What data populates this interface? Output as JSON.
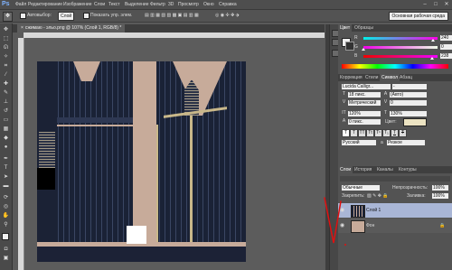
{
  "app": {
    "logo": "Ps"
  },
  "menu": [
    "Файл",
    "Редактирование",
    "Изображение",
    "Слои",
    "Текст",
    "Выделение",
    "Фильтр",
    "3D",
    "Просмотр",
    "Окно",
    "Справка"
  ],
  "window_controls": [
    "–",
    "□",
    "✕"
  ],
  "options_bar": {
    "auto_select_label": "Автовыбор:",
    "auto_select_value": "Слой",
    "show_controls_label": "Показать упр. элем.",
    "workspace": "Основная рабочая среда"
  },
  "document_tab": {
    "close": "×",
    "title": "сжимаю - эльо.png @ 107% (Слой 1, RGB/8) *"
  },
  "color_panel": {
    "tabs": [
      "Цвет",
      "Образцы"
    ],
    "channels": [
      {
        "label": "R",
        "value": "240",
        "gradient": [
          "#00f0e8",
          "#ff00e8"
        ],
        "knob": 0.94
      },
      {
        "label": "G",
        "value": "0",
        "gradient": [
          "#f000e8",
          "#f0ffe8"
        ],
        "knob": 0.0
      },
      {
        "label": "B",
        "value": "238",
        "gradient": [
          "#f00000",
          "#f000ff"
        ],
        "knob": 0.93
      }
    ]
  },
  "character_panel": {
    "tabs": [
      "Коррекция",
      "Стили",
      "Символ",
      "Абзац"
    ],
    "font_family": "Lucida Calligr...",
    "font_style": "-",
    "size": "18 пикс.",
    "leading": "(Авто)",
    "kerning": "Метрический",
    "tracking": "0",
    "vertical_scale": "120%",
    "horizontal_scale": "130%",
    "baseline": "0 пикс.",
    "color_label": "Цвет:",
    "format_buttons": [
      "T",
      "T",
      "TT",
      "Tt",
      "T¹",
      "T₁",
      "T",
      "T"
    ],
    "language": "Русский",
    "antialias": "Резкое"
  },
  "layers_panel": {
    "tabs": [
      "Слои",
      "История",
      "Каналы",
      "Контуры"
    ],
    "blend_mode": "Обычные",
    "opacity_label": "Непрозрачность:",
    "opacity": "100%",
    "lock_label": "Закрепить:",
    "fill_label": "Заливка:",
    "fill": "100%",
    "layers": [
      {
        "name": "Слой 1",
        "selected": true,
        "visible": true
      },
      {
        "name": "Фон",
        "selected": false,
        "visible": true
      }
    ]
  },
  "colors": {
    "dress_navy": "#181f30",
    "skin_tone": "#c7ab9a",
    "trim_gold": "#c9b88a",
    "annotation_red": "#e01010",
    "selected_layer": "#a9b6d6"
  },
  "icons": [
    "move-tool-icon",
    "marquee-tool-icon",
    "lasso-tool-icon",
    "magic-wand-icon",
    "crop-tool-icon",
    "eyedropper-icon",
    "healing-brush-icon",
    "brush-tool-icon",
    "clone-stamp-icon",
    "history-brush-icon",
    "eraser-icon",
    "gradient-tool-icon",
    "blur-tool-icon",
    "dodge-tool-icon",
    "pen-tool-icon",
    "type-tool-icon",
    "path-select-icon",
    "shape-tool-icon",
    "hand-tool-icon",
    "zoom-tool-icon",
    "eye-icon",
    "lock-icon"
  ]
}
